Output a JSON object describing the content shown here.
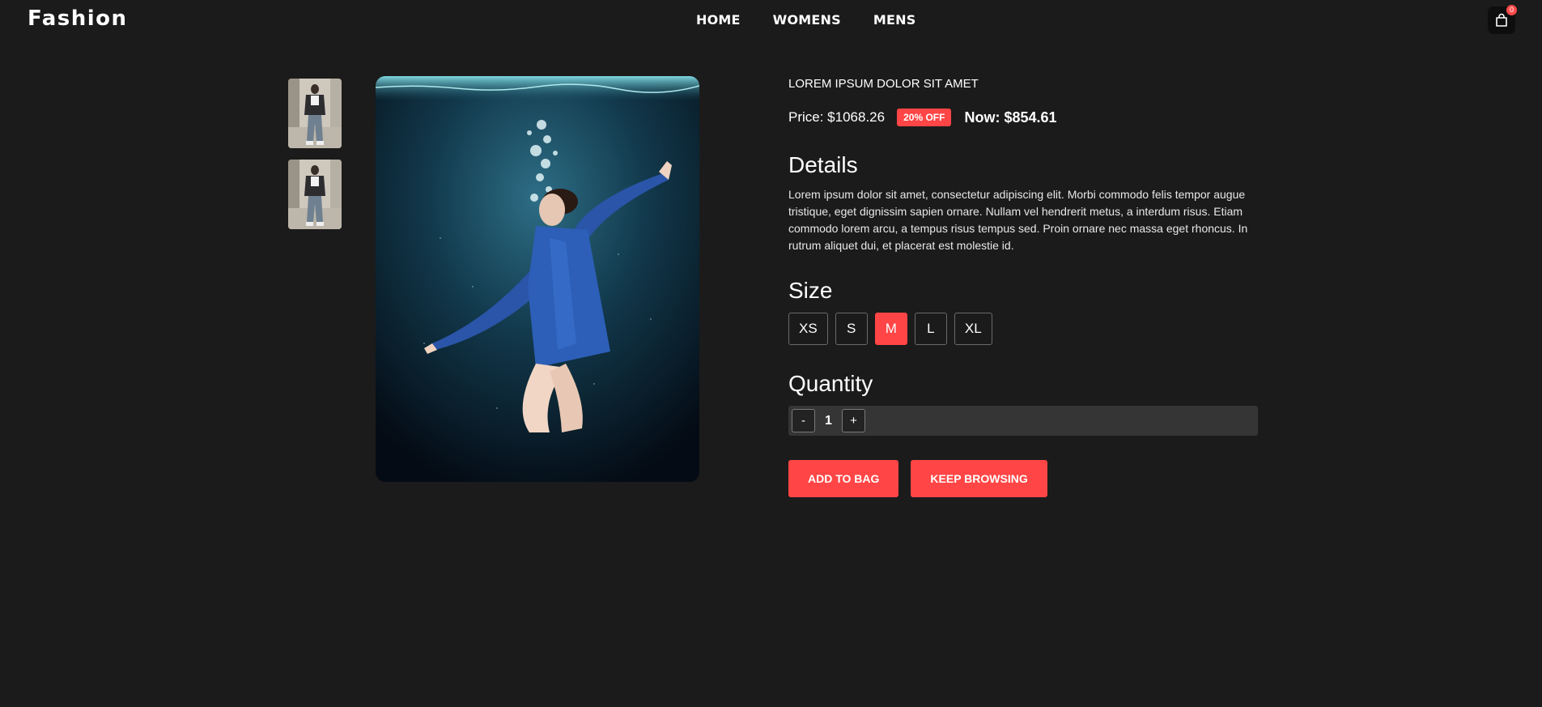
{
  "header": {
    "logo": "Fashion",
    "nav": [
      "HOME",
      "WOMENS",
      "MENS"
    ],
    "cart_count": "0",
    "cart_icon": "shopping-bag-icon"
  },
  "product": {
    "name": "LOREM IPSUM DOLOR SIT AMET",
    "price_label": "Price: $1068.26",
    "discount_badge": "20% OFF",
    "now_price_label": "Now: $854.61",
    "details_title": "Details",
    "details_text": "Lorem ipsum dolor sit amet, consectetur adipiscing elit. Morbi commodo felis tempor augue tristique, eget dignissim sapien ornare. Nullam vel hendrerit metus, a interdum risus. Etiam commodo lorem arcu, a tempus risus tempus sed. Proin ornare nec massa eget rhoncus. In rutrum aliquet dui, et placerat est molestie id.",
    "size_title": "Size",
    "sizes": [
      "XS",
      "S",
      "M",
      "L",
      "XL"
    ],
    "selected_size": "M",
    "quantity_title": "Quantity",
    "quantity": "1",
    "qty_minus": "-",
    "qty_plus": "+",
    "add_to_bag": "ADD TO BAG",
    "keep_browsing": "KEEP BROWSING"
  },
  "colors": {
    "background": "#1b1b1b",
    "accent": "#ff4545",
    "qty_bar": "#353535"
  }
}
